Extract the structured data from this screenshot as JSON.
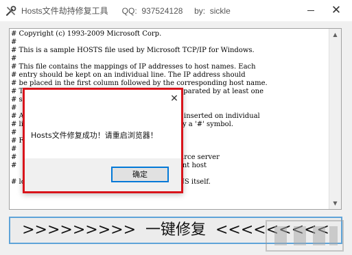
{
  "window": {
    "title": "Hosts文件劫持修复工具      QQ:  937524128     by:  sickle",
    "minimize_icon": "minimize-icon",
    "close_glyph": "✕"
  },
  "hosts_lines": [
    "# Copyright (c) 1993-2009 Microsoft Corp.",
    "#",
    "# This is a sample HOSTS file used by Microsoft TCP/IP for Windows.",
    "#",
    "# This file contains the mappings of IP addresses to host names. Each",
    "# entry should be kept on an individual line. The IP address should",
    "# be placed in the first column followed by the corresponding host name.",
    "# The IP address and the host name should be separated by at least one",
    "# space.",
    "#",
    "# Additionally, comments (such as these) may be inserted on individual",
    "# lines or following the machine name denoted by a '#' symbol.",
    "#",
    "# For example:",
    "#",
    "#      102.54.94.97     rhino.acme.com          # source server",
    "#       38.25.63.10     x.acme.com              # x client host",
    "",
    "# localhost name resolution is handled within DNS itself."
  ],
  "repair_button": {
    "label": ">>>>>>>>>  一键修复  <<<<<<<<<"
  },
  "dialog": {
    "message": "Hosts文件修复成功！请重启浏览器！",
    "ok_label": "确定",
    "close_glyph": "✕"
  },
  "scroll": {
    "up": "▲",
    "down": "▼"
  },
  "colors": {
    "dialog_border": "#d9141b",
    "button_border": "#5ea3d8",
    "focus": "#0078d7"
  }
}
